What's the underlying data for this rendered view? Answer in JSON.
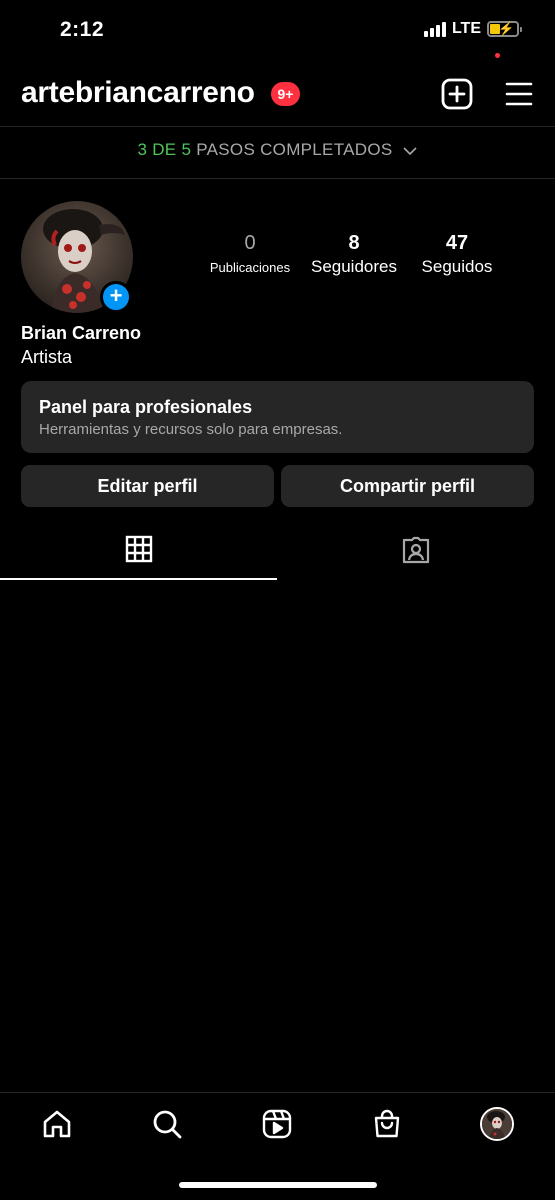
{
  "status_bar": {
    "time": "2:12",
    "network": "LTE",
    "battery_level": 0.4,
    "battery_charging": true
  },
  "header": {
    "username": "artebriancarreno",
    "notification_badge": "9+",
    "add_icon": "plus-square-icon",
    "menu_icon": "hamburger-menu-icon"
  },
  "steps_banner": {
    "completed": "3 DE 5",
    "label": "PASOS COMPLETADOS"
  },
  "profile": {
    "stats": {
      "posts_count": "0",
      "posts_label": "Publicaciones",
      "followers_count": "8",
      "followers_label": "Seguidores",
      "following_count": "47",
      "following_label": "Seguidos"
    },
    "name": "Brian Carreno",
    "category": "Artista"
  },
  "pro_panel": {
    "title": "Panel para profesionales",
    "subtitle": "Herramientas y recursos solo para empresas."
  },
  "buttons": {
    "edit": "Editar perfil",
    "share": "Compartir perfil"
  },
  "tabs": [
    {
      "icon": "grid-icon",
      "active": true
    },
    {
      "icon": "tagged-person-icon",
      "active": false
    }
  ],
  "bottom_nav": [
    "home-icon",
    "search-icon",
    "reels-icon",
    "shop-icon",
    "profile-avatar"
  ],
  "colors": {
    "background": "#000000",
    "surface": "#262626",
    "accent_green": "#4fc45a",
    "badge_red": "#ff3040",
    "blue": "#0095f6",
    "muted_text": "#a8a8a8"
  }
}
